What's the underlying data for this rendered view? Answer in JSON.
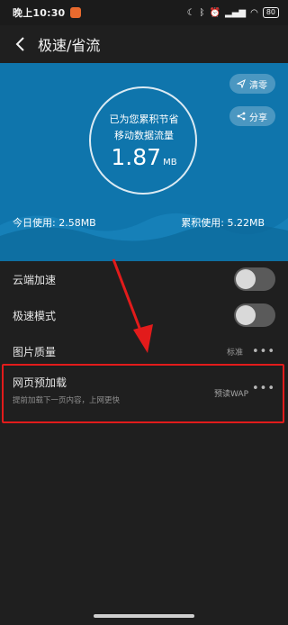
{
  "status": {
    "time": "晚上10:30",
    "battery": "80"
  },
  "app_bar": {
    "title": "极速/省流"
  },
  "hero": {
    "saved_line1": "已为您累积节省",
    "saved_line2": "移动数据流量",
    "saved_value": "1.87",
    "saved_unit": "MB",
    "clear_label": "清零",
    "share_label": "分享",
    "today_usage": "今日使用: 2.58MB",
    "total_usage": "累积使用: 5.22MB",
    "bg_color": "#0f75ac"
  },
  "settings": {
    "cloud_accel": {
      "label": "云端加速",
      "enabled": false
    },
    "speed_mode": {
      "label": "极速模式",
      "enabled": false
    },
    "image_quality": {
      "label": "图片质量",
      "value": "标准"
    },
    "page_preload": {
      "label": "网页预加载",
      "description": "提前加载下一页内容，上网更快",
      "value": "预读WAP"
    }
  },
  "annotation": {
    "highlight_color": "#e21b1b"
  }
}
